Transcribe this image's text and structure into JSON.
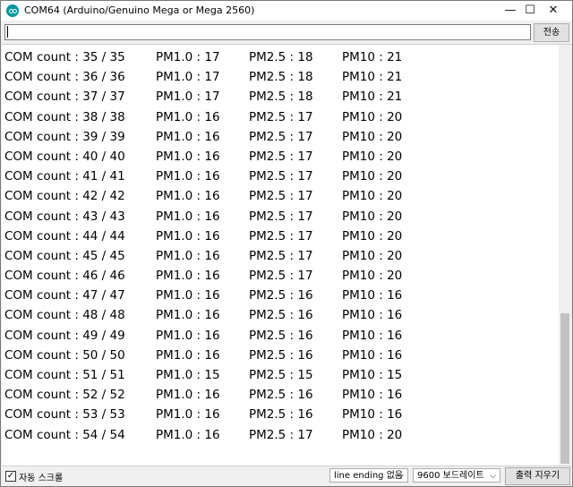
{
  "window": {
    "title": "COM64 (Arduino/Genuino Mega or Mega 2560)",
    "minimize_glyph": "—",
    "maximize_glyph": "☐",
    "close_glyph": "✕",
    "app_icon": "arduino-logo-icon",
    "accent_color": "#00979c"
  },
  "toolbar": {
    "input_value": "",
    "send_label": "전송"
  },
  "output": {
    "lines": [
      {
        "count": "COM count : 35 / 35",
        "pm1": "PM1.0 : 17",
        "pm25": "PM2.5 : 18",
        "pm10": "PM10 : 21"
      },
      {
        "count": "COM count : 36 / 36",
        "pm1": "PM1.0 : 17",
        "pm25": "PM2.5 : 18",
        "pm10": "PM10 : 21"
      },
      {
        "count": "COM count : 37 / 37",
        "pm1": "PM1.0 : 17",
        "pm25": "PM2.5 : 18",
        "pm10": "PM10 : 21"
      },
      {
        "count": "COM count : 38 / 38",
        "pm1": "PM1.0 : 16",
        "pm25": "PM2.5 : 17",
        "pm10": "PM10 : 20"
      },
      {
        "count": "COM count : 39 / 39",
        "pm1": "PM1.0 : 16",
        "pm25": "PM2.5 : 17",
        "pm10": "PM10 : 20"
      },
      {
        "count": "COM count : 40 / 40",
        "pm1": "PM1.0 : 16",
        "pm25": "PM2.5 : 17",
        "pm10": "PM10 : 20"
      },
      {
        "count": "COM count : 41 / 41",
        "pm1": "PM1.0 : 16",
        "pm25": "PM2.5 : 17",
        "pm10": "PM10 : 20"
      },
      {
        "count": "COM count : 42 / 42",
        "pm1": "PM1.0 : 16",
        "pm25": "PM2.5 : 17",
        "pm10": "PM10 : 20"
      },
      {
        "count": "COM count : 43 / 43",
        "pm1": "PM1.0 : 16",
        "pm25": "PM2.5 : 17",
        "pm10": "PM10 : 20"
      },
      {
        "count": "COM count : 44 / 44",
        "pm1": "PM1.0 : 16",
        "pm25": "PM2.5 : 17",
        "pm10": "PM10 : 20"
      },
      {
        "count": "COM count : 45 / 45",
        "pm1": "PM1.0 : 16",
        "pm25": "PM2.5 : 17",
        "pm10": "PM10 : 20"
      },
      {
        "count": "COM count : 46 / 46",
        "pm1": "PM1.0 : 16",
        "pm25": "PM2.5 : 17",
        "pm10": "PM10 : 20"
      },
      {
        "count": "COM count : 47 / 47",
        "pm1": "PM1.0 : 16",
        "pm25": "PM2.5 : 16",
        "pm10": "PM10 : 16"
      },
      {
        "count": "COM count : 48 / 48",
        "pm1": "PM1.0 : 16",
        "pm25": "PM2.5 : 16",
        "pm10": "PM10 : 16"
      },
      {
        "count": "COM count : 49 / 49",
        "pm1": "PM1.0 : 16",
        "pm25": "PM2.5 : 16",
        "pm10": "PM10 : 16"
      },
      {
        "count": "COM count : 50 / 50",
        "pm1": "PM1.0 : 16",
        "pm25": "PM2.5 : 16",
        "pm10": "PM10 : 16"
      },
      {
        "count": "COM count : 51 / 51",
        "pm1": "PM1.0 : 15",
        "pm25": "PM2.5 : 15",
        "pm10": "PM10 : 15"
      },
      {
        "count": "COM count : 52 / 52",
        "pm1": "PM1.0 : 16",
        "pm25": "PM2.5 : 16",
        "pm10": "PM10 : 16"
      },
      {
        "count": "COM count : 53 / 53",
        "pm1": "PM1.0 : 16",
        "pm25": "PM2.5 : 16",
        "pm10": "PM10 : 16"
      },
      {
        "count": "COM count : 54 / 54",
        "pm1": "PM1.0 : 16",
        "pm25": "PM2.5 : 17",
        "pm10": "PM10 : 20"
      }
    ]
  },
  "statusbar": {
    "autoscroll_checked": true,
    "autoscroll_label": "자동 스크롤",
    "line_ending": "line ending 없음",
    "baud_rate": "9600 보드레이트",
    "clear_label": "출력 지우기",
    "dropdown_glyph": "⌵"
  }
}
